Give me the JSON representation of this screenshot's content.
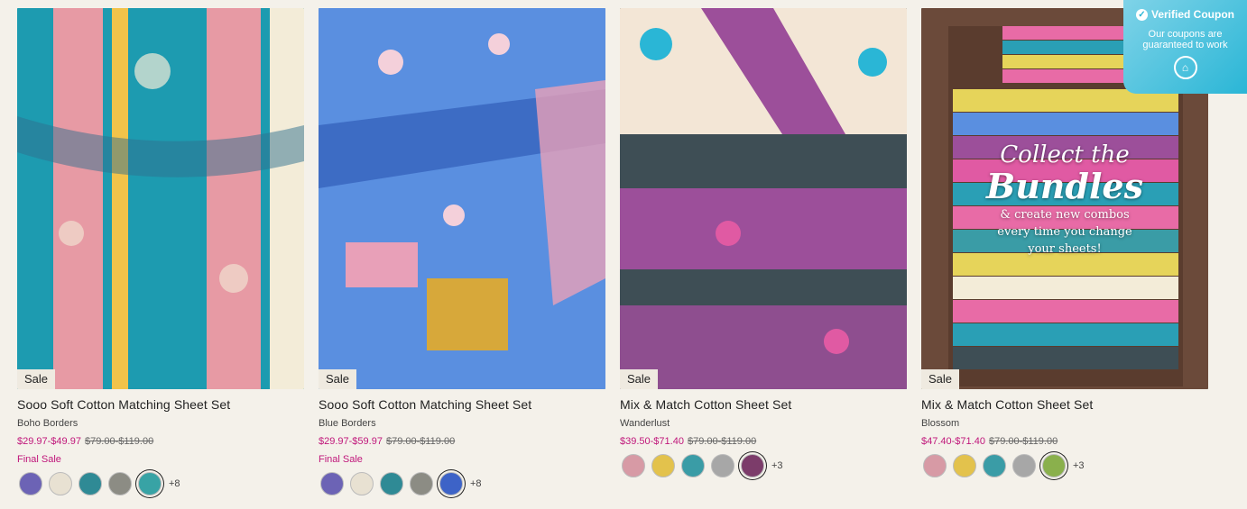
{
  "products": [
    {
      "sale_badge": "Sale",
      "title": "Sooo Soft Cotton Matching Sheet Set",
      "variant": "Boho Borders",
      "price_now": "$29.97-$49.97",
      "price_was": "$79.00-$119.00",
      "final_sale": "Final Sale",
      "more_swatches": "+8",
      "colors": [
        "#1d9bb0",
        "#e79aa4",
        "#f2c34a",
        "#2f6f8e"
      ]
    },
    {
      "sale_badge": "Sale",
      "title": "Sooo Soft Cotton Matching Sheet Set",
      "variant": "Blue Borders",
      "price_now": "$29.97-$59.97",
      "price_was": "$79.00-$119.00",
      "final_sale": "Final Sale",
      "more_swatches": "+8",
      "colors": [
        "#5a8fe0",
        "#e8a0b8",
        "#d7a83a",
        "#3d6cc4"
      ]
    },
    {
      "sale_badge": "Sale",
      "title": "Mix & Match Cotton Sheet Set",
      "variant": "Wanderlust",
      "price_now": "$39.50-$71.40",
      "price_was": "$79.00-$119.00",
      "more_swatches": "+3",
      "colors": [
        "#3e4e55",
        "#9c4f9a",
        "#e05aa3",
        "#f3e6d6"
      ]
    },
    {
      "sale_badge": "Sale",
      "title": "Mix & Match Cotton Sheet Set",
      "variant": "Blossom",
      "price_now": "$47.40-$71.40",
      "price_was": "$79.00-$119.00",
      "more_swatches": "+3",
      "colors": [
        "#6b4a3a",
        "#e6d45a",
        "#2a9fb5",
        "#e86ba6"
      ]
    }
  ],
  "bundle_overlay": {
    "line1": "Collect the",
    "line2": "Bundles",
    "line3": "& create new combos",
    "line4": "every time you change",
    "line5": "your sheets!"
  },
  "coupon": {
    "title": "Verified Coupon",
    "line1": "Our coupons are",
    "line2": "guaranteed to work",
    "check_icon": "check-circle-icon",
    "tag_icon": "price-tag-icon"
  },
  "swatch_sets": {
    "a": [
      "#6c63b5",
      "#e8e1d2",
      "#2f8a95",
      "#8c8c84",
      "#38a3a5"
    ],
    "b": [
      "#6c63b5",
      "#e8e1d2",
      "#2f8a95",
      "#8c8c84",
      "#3d63c7"
    ],
    "c": [
      "#d79aa5",
      "#e3c24c",
      "#3a9ca6",
      "#a7a7a7",
      "#7c3c6a"
    ],
    "d": [
      "#d79aa5",
      "#e3c24c",
      "#3a9ca6",
      "#a7a7a7",
      "#8ab04c"
    ]
  }
}
